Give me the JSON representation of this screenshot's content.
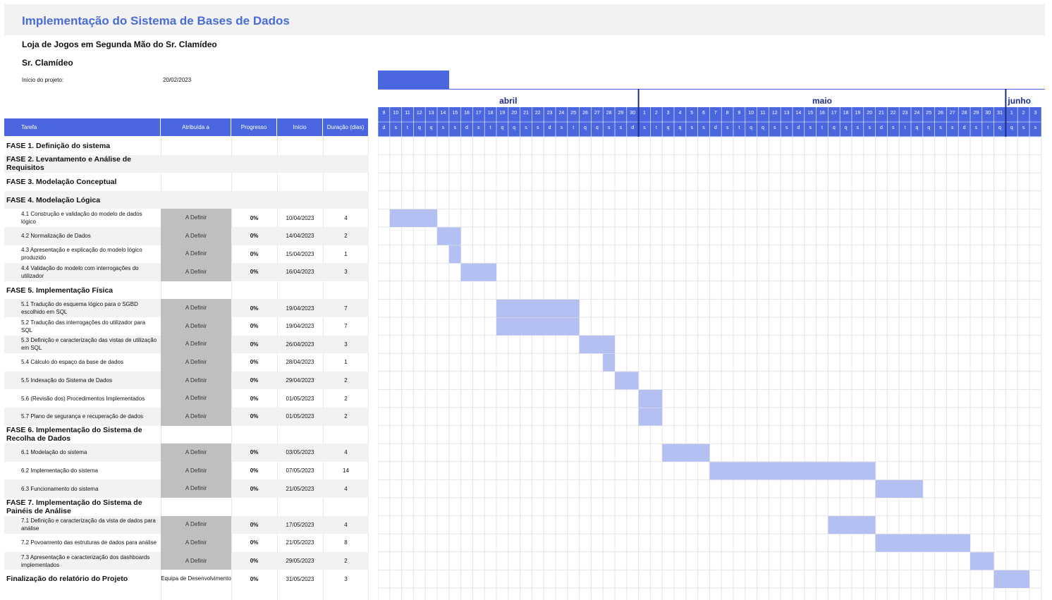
{
  "header": {
    "title": "Implementação do Sistema de Bases de Dados",
    "subtitle": "Loja de Jogos em Segunda Mão do Sr. Clamídeo",
    "owner": "Sr. Clamídeo",
    "start_label": "Início do projeto:",
    "start_value": "20/02/2023"
  },
  "columns": {
    "task": "Tarefa",
    "assigned": "Atribuída a",
    "progress": "Progresso",
    "start": "Início",
    "duration": "Duração (dias)"
  },
  "colors": {
    "accent": "#4a67e0",
    "title": "#4a6cd6",
    "bar": "#b4c0f2",
    "assign_gray": "#bfbfbf",
    "month_line": "#1f2d8a"
  },
  "chart_data": {
    "type": "gantt",
    "months": [
      {
        "name": "abril",
        "days": [
          9,
          10,
          11,
          12,
          13,
          14,
          15,
          16,
          17,
          18,
          19,
          20,
          21,
          22,
          23,
          24,
          25,
          26,
          27,
          28,
          29,
          30
        ]
      },
      {
        "name": "maio",
        "days": [
          1,
          2,
          3,
          4,
          5,
          6,
          7,
          8,
          9,
          10,
          11,
          12,
          13,
          14,
          15,
          16,
          17,
          18,
          19,
          20,
          21,
          22,
          23,
          24,
          25,
          26,
          27,
          28,
          29,
          30,
          31
        ]
      },
      {
        "name": "junho",
        "days": [
          1,
          2,
          3
        ]
      }
    ],
    "weekday_letters": [
      "d",
      "s",
      "t",
      "q",
      "q",
      "s",
      "s",
      "d",
      "s",
      "t",
      "q",
      "q",
      "s",
      "s",
      "d",
      "s",
      "t",
      "q",
      "q",
      "s",
      "s",
      "d",
      "s",
      "t",
      "q",
      "q",
      "s",
      "s",
      "d",
      "s",
      "t",
      "q",
      "q",
      "s",
      "s",
      "d",
      "s",
      "t",
      "q",
      "q",
      "s",
      "s",
      "d",
      "s",
      "t",
      "q",
      "q",
      "s",
      "s",
      "d",
      "s",
      "t",
      "q",
      "q",
      "s",
      "s"
    ],
    "rows": [
      {
        "kind": "phase",
        "name": "FASE 1. Definição do sistema"
      },
      {
        "kind": "phase",
        "name": "FASE 2. Levantamento e Análise de Requisitos"
      },
      {
        "kind": "phase",
        "name": "FASE 3. Modelação Conceptual"
      },
      {
        "kind": "phase",
        "name": "FASE 4. Modelação Lógica"
      },
      {
        "kind": "task",
        "name": "4.1 Construção e validação do modelo de dados lógico",
        "assigned": "A Definir",
        "progress": "0%",
        "start": "10/04/2023",
        "duration": 4,
        "start_index": 1
      },
      {
        "kind": "task",
        "name": "4.2 Normalização de Dados",
        "assigned": "A Definir",
        "progress": "0%",
        "start": "14/04/2023",
        "duration": 2,
        "start_index": 5
      },
      {
        "kind": "task",
        "name": "4.3 Apresentação e explicação do modelo lógico produzido",
        "assigned": "A Definir",
        "progress": "0%",
        "start": "15/04/2023",
        "duration": 1,
        "start_index": 6
      },
      {
        "kind": "task",
        "name": "4.4 Validação do modelo com interrogações do utilizador",
        "assigned": "A Definir",
        "progress": "0%",
        "start": "16/04/2023",
        "duration": 3,
        "start_index": 7
      },
      {
        "kind": "phase",
        "name": "FASE 5. Implementação Física"
      },
      {
        "kind": "task",
        "name": "5.1 Tradução do esquema lógico para o SGBD escolhido em SQL",
        "assigned": "A Definir",
        "progress": "0%",
        "start": "19/04/2023",
        "duration": 7,
        "start_index": 10
      },
      {
        "kind": "task",
        "name": "5.2 Tradução das interrogações do utilizador para SQL",
        "assigned": "A Definir",
        "progress": "0%",
        "start": "19/04/2023",
        "duration": 7,
        "start_index": 10
      },
      {
        "kind": "task",
        "name": "5.3 Definição e caracterização das vistas de utilização em SQL",
        "assigned": "A Definir",
        "progress": "0%",
        "start": "26/04/2023",
        "duration": 3,
        "start_index": 17
      },
      {
        "kind": "task",
        "name": "5.4 Cálculo do espaço da base de dados",
        "assigned": "A Definir",
        "progress": "0%",
        "start": "28/04/2023",
        "duration": 1,
        "start_index": 19
      },
      {
        "kind": "task",
        "name": "5.5 Indexação do Sistema de Dados",
        "assigned": "A Definir",
        "progress": "0%",
        "start": "29/04/2023",
        "duration": 2,
        "start_index": 20
      },
      {
        "kind": "task",
        "name": "5.6 (Revisão dos) Procedimentos Implementados",
        "assigned": "A Definir",
        "progress": "0%",
        "start": "01/05/2023",
        "duration": 2,
        "start_index": 22
      },
      {
        "kind": "task",
        "name": "5.7 Plano de segurança e recuperação de dados",
        "assigned": "A Definir",
        "progress": "0%",
        "start": "01/05/2023",
        "duration": 2,
        "start_index": 22
      },
      {
        "kind": "phase",
        "name": "FASE 6. Implementação do Sistema de Recolha de Dados"
      },
      {
        "kind": "task",
        "name": "6.1 Modelação do sistema",
        "assigned": "A Definir",
        "progress": "0%",
        "start": "03/05/2023",
        "duration": 4,
        "start_index": 24
      },
      {
        "kind": "task",
        "name": "6.2 Implementação do sistema",
        "assigned": "A Definir",
        "progress": "0%",
        "start": "07/05/2023",
        "duration": 14,
        "start_index": 28
      },
      {
        "kind": "task",
        "name": "6.3 Funcionamento do sistema",
        "assigned": "A Definir",
        "progress": "0%",
        "start": "21/05/2023",
        "duration": 4,
        "start_index": 42
      },
      {
        "kind": "phase",
        "name": "FASE 7. Implementação do Sistema de Painéis de Análise"
      },
      {
        "kind": "task",
        "name": "7.1 Definição e caracterização da vista de dados para análise",
        "assigned": "A Definir",
        "progress": "0%",
        "start": "17/05/2023",
        "duration": 4,
        "start_index": 38
      },
      {
        "kind": "task",
        "name": "7.2 Povoamento das estruturas de dados para análise",
        "assigned": "A Definir",
        "progress": "0%",
        "start": "21/05/2023",
        "duration": 8,
        "start_index": 42
      },
      {
        "kind": "task",
        "name": "7.3 Apresentação e caracterização dos dashboards implementados",
        "assigned": "A Definir",
        "progress": "0%",
        "start": "29/05/2023",
        "duration": 2,
        "start_index": 50
      },
      {
        "kind": "final",
        "name": "Finalização do relatório do Projeto",
        "assigned": "Equipa de Desenvolvimento",
        "progress": "0%",
        "start": "31/05/2023",
        "duration": 3,
        "start_index": 52
      }
    ]
  }
}
